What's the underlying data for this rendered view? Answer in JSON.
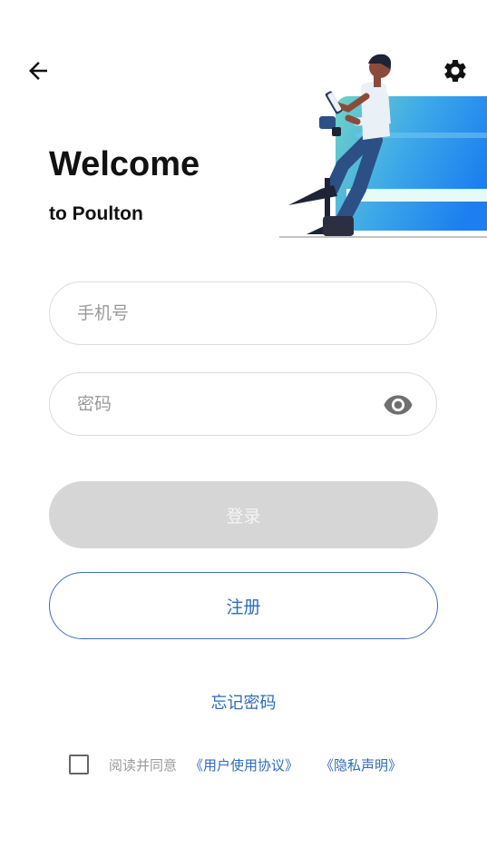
{
  "header": {
    "back_icon": "arrow-left-icon",
    "settings_icon": "gear-icon"
  },
  "welcome": {
    "title": "Welcome",
    "subtitle": "to Poulton"
  },
  "form": {
    "phone": {
      "placeholder": "手机号",
      "value": ""
    },
    "password": {
      "placeholder": "密码",
      "value": "",
      "toggle_icon": "eye-icon"
    }
  },
  "buttons": {
    "login_label": "登录",
    "register_label": "注册",
    "forgot_label": "忘记密码"
  },
  "agreement": {
    "checked": false,
    "text": "阅读并同意",
    "user_agreement": "《用户使用协议》",
    "privacy": "《隐私声明》"
  },
  "colors": {
    "accent": "#2f6bbd",
    "disabled_button": "#d6d6d6",
    "placeholder": "#9a9a9a"
  }
}
